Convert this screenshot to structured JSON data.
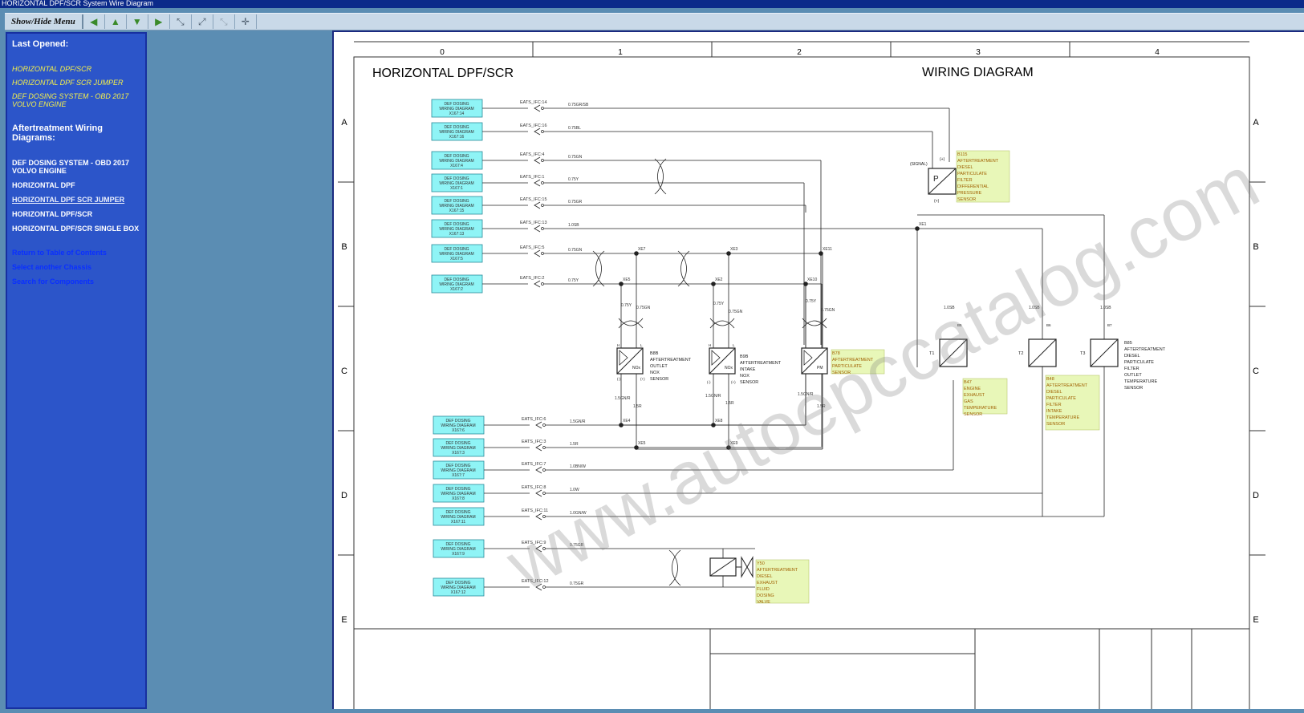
{
  "window": {
    "title": "HORIZONTAL DPF/SCR System Wire Diagram"
  },
  "toolbar": {
    "menu_label": "Show/Hide Menu"
  },
  "sidebar": {
    "last_opened_heading": "Last Opened:",
    "last_opened": [
      "HORIZONTAL DPF/SCR",
      "HORIZONTAL DPF SCR JUMPER",
      "DEF DOSING SYSTEM - OBD 2017 VOLVO ENGINE"
    ],
    "section_heading": "Aftertreatment Wiring Diagrams:",
    "diagrams": [
      "DEF DOSING SYSTEM - OBD 2017 VOLVO ENGINE",
      "HORIZONTAL DPF",
      "HORIZONTAL DPF SCR JUMPER",
      "HORIZONTAL DPF/SCR",
      "HORIZONTAL DPF/SCR SINGLE BOX"
    ],
    "nav": [
      "Return to Table of Contents",
      "Select another Chassis",
      "Search for Components"
    ]
  },
  "diagram": {
    "title_left": "HORIZONTAL DPF/SCR",
    "title_right": "WIRING DIAGRAM",
    "col_labels": [
      "0",
      "1",
      "2",
      "3",
      "4"
    ],
    "row_labels": [
      "A",
      "B",
      "C",
      "D",
      "E"
    ],
    "watermark": "www.autoepccatalog.com",
    "connector_text": [
      "DEF DOSING",
      "WIRING DIAGRAM"
    ],
    "connector_ids": [
      "X167:14",
      "X167:16",
      "X167:4",
      "X167:1",
      "X167:15",
      "X167:13",
      "X167:5",
      "X167:2",
      "X167:6",
      "X167:3",
      "X167:7",
      "X167:8",
      "X167:11",
      "X167:9",
      "X167:12"
    ],
    "pin_labels": [
      "EATS_IFC:14",
      "EATS_IFC:16",
      "EATS_IFC:4",
      "EATS_IFC:1",
      "EATS_IFC:15",
      "EATS_IFC:13",
      "EATS_IFC:5",
      "EATS_IFC:2",
      "EATS_IFC:6",
      "EATS_IFC:3",
      "EATS_IFC:7",
      "EATS_IFC:8",
      "EATS_IFC:11",
      "EATS_IFC:9",
      "EATS_IFC:12"
    ],
    "wire_labels": [
      "0.75GR/SB",
      "0.75BL",
      "0.75GN",
      "0.75Y",
      "0.75GR",
      "1.0SB",
      "0.75GN",
      "0.75Y",
      "1.5GN/R",
      "1.5R",
      "1.0BN/W",
      "1.0W",
      "1.0GN/W",
      "0.75GR",
      "0.75GR"
    ],
    "splices": [
      "XE7",
      "XE3",
      "XE11",
      "XE5",
      "XE2",
      "XE10",
      "XE4",
      "XE8",
      "XE5",
      "XE9",
      "XE1"
    ],
    "components": {
      "b115": {
        "id": "B115",
        "text": [
          "AFTERTREATMENT",
          "DIESEL",
          "PARTICULATE",
          "FILTER",
          "DIFFERENTIAL",
          "PRESSURE",
          "SENSOR"
        ],
        "signal": "(SIGNAL)",
        "plus": "(+)",
        "minus": "(+)",
        "symbol": "P"
      },
      "b8b": {
        "id": "B8B",
        "text": [
          "AFTERTREATMENT",
          "OUTLET",
          "NOX",
          "SENSOR"
        ],
        "symbol": "NOx"
      },
      "b9b": {
        "id": "B9B",
        "text": [
          "AFTERTREATMENT",
          "INTAKE",
          "NOX",
          "SENSOR"
        ],
        "symbol": "NOx"
      },
      "b78": {
        "id": "B78",
        "text": [
          "AFTERTREATMENT",
          "PARTICULATE",
          "SENSOR"
        ],
        "symbol": "PM"
      },
      "b47": {
        "id": "B47",
        "text": [
          "ENGINE",
          "EXHAUST",
          "GAS",
          "TEMPERATURE",
          "SENSOR"
        ],
        "terminal": "T1"
      },
      "b48": {
        "id": "B48",
        "text": [
          "AFTERTREATMENT",
          "DIESEL",
          "PARTICULATE",
          "FILTER",
          "INTAKE",
          "TEMPERATURE",
          "SENSOR"
        ],
        "terminal": "T2"
      },
      "b85": {
        "id": "B85",
        "text": [
          "AFTERTREATMENT",
          "DIESEL",
          "PARTICULATE",
          "FILTER",
          "OUTLET",
          "TEMPERATURE",
          "SENSOR"
        ],
        "terminal": "T3"
      },
      "y50": {
        "id": "Y50",
        "text": [
          "AFTERTREATMENT",
          "DIESEL",
          "EXHAUST",
          "FLUID",
          "DOSING",
          "VALVE"
        ]
      }
    },
    "small_wires": [
      "1.0SB",
      "1.0SB",
      "1.0SB",
      "0.75Y",
      "0.75GN",
      "0.75Y",
      "0.75GN",
      "0.75Y",
      "0.75GN",
      "1.5GN/R",
      "1.5R",
      "1.5GN/R",
      "1.5R",
      "1.5GN/R",
      "1.5R"
    ],
    "pin_marks": [
      "H",
      "L",
      "(-)",
      "(+)",
      "B5",
      "B6",
      "B7",
      "1",
      "2",
      "3",
      "4"
    ]
  }
}
